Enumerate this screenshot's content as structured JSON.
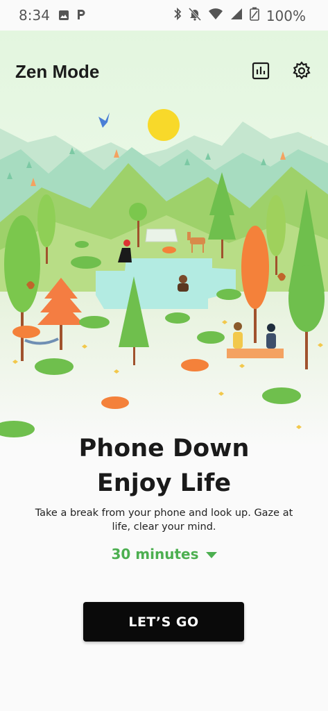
{
  "status_bar": {
    "time": "8:34",
    "battery": "100%",
    "icons": [
      "image-icon",
      "parking-icon",
      "bluetooth-icon",
      "do-not-disturb-icon",
      "wifi-icon",
      "signal-icon",
      "battery-icon"
    ]
  },
  "app_bar": {
    "title": "Zen Mode",
    "stats_icon": "stats-icon",
    "settings_icon": "gear-icon"
  },
  "main": {
    "heading_line1": "Phone Down",
    "heading_line2": "Enjoy Life",
    "description": "Take a break from your phone and look up. Gaze at life, clear your mind.",
    "duration": "30 minutes",
    "cta": "LET’S GO"
  },
  "colors": {
    "accent": "#4caf50",
    "button": "#0a0a0a"
  }
}
